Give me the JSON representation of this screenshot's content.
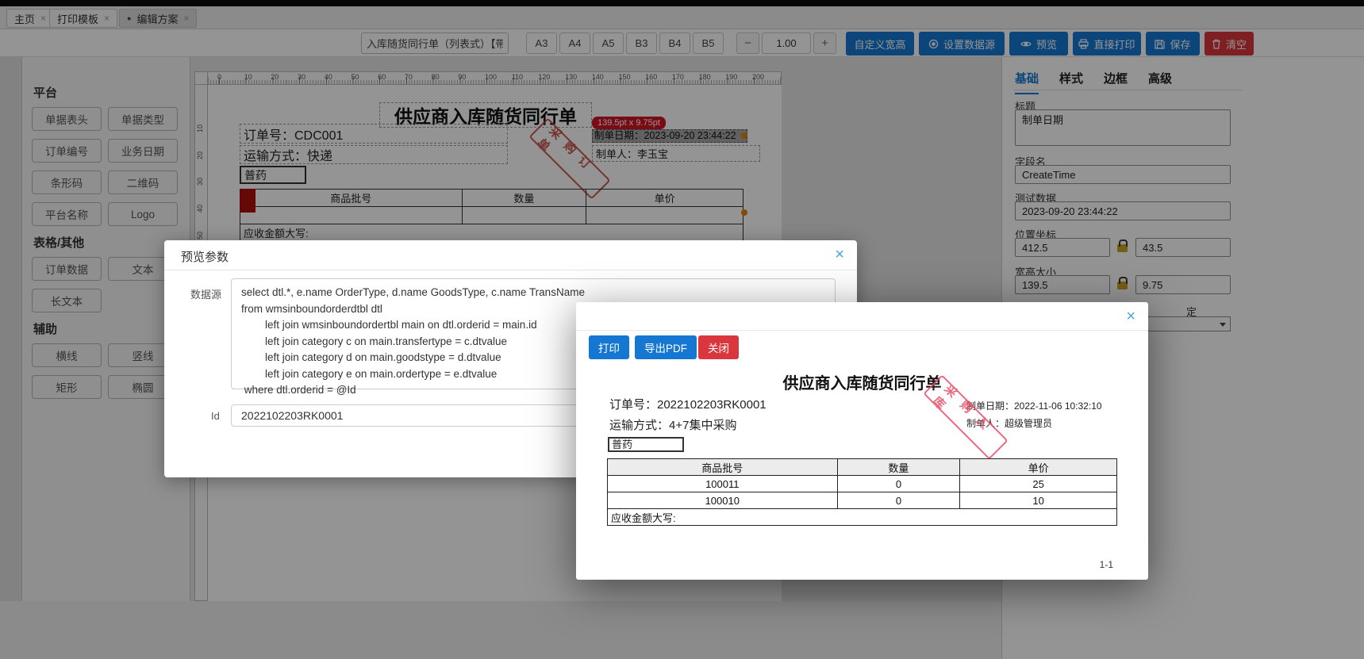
{
  "colors": {
    "primary": "#1677d2",
    "danger": "#d9363e",
    "tooltip-red": "#cf1322",
    "sel-gray": "#a8a8a8",
    "stamp1": "#bf3a35",
    "stamp2": "#e8506a",
    "lock-gold": "#c9a227",
    "tbl-red": "#b00f0f",
    "handle-orange": "#e08600"
  },
  "tabs": [
    {
      "label": "主页",
      "close": "×"
    },
    {
      "label": "打印模板",
      "close": "×"
    },
    {
      "label": "编辑方案",
      "dot": "●",
      "close": "×"
    }
  ],
  "toolbar": {
    "template_name": "入库随货同行单（列表式）【带",
    "paper_sizes": [
      "A3",
      "A4",
      "A5",
      "B3",
      "B4",
      "B5"
    ],
    "zoom_minus": "−",
    "zoom_value": "1.00",
    "zoom_plus": "+",
    "custom_size": "自定义宽高",
    "set_datasource": "设置数据源",
    "preview": "预览",
    "direct_print": "直接打印",
    "save": "保存",
    "clear": "清空"
  },
  "sidebar": {
    "sections": [
      {
        "title": "平台",
        "items": [
          "单据表头",
          "单据类型",
          "订单编号",
          "业务日期",
          "条形码",
          "二维码",
          "平台名称",
          "Logo"
        ]
      },
      {
        "title": "表格/其他",
        "items": [
          "订单数据",
          "文本",
          "长文本"
        ]
      },
      {
        "title": "辅助",
        "items": [
          "横线",
          "竖线",
          "矩形",
          "椭圆"
        ]
      }
    ]
  },
  "canvas": {
    "ruler_h": [
      "0",
      "10",
      "20",
      "30",
      "40",
      "50",
      "60",
      "70",
      "80",
      "90",
      "100",
      "110",
      "120",
      "130",
      "140",
      "150",
      "160",
      "170",
      "180",
      "190",
      "200"
    ],
    "ruler_v": [
      "10",
      "20",
      "30",
      "40",
      "50"
    ],
    "doc": {
      "title": "供应商入库随货同行单",
      "order_no": "订单号：CDC001",
      "transport": "运输方式：快递",
      "drug_type": "普药",
      "tooltip": "139.5pt x 9.75pt",
      "make_date": "制单日期：2023-09-20 23:44:22",
      "maker": "制单人：李玉宝",
      "stamp": "采购订单",
      "table_headers": [
        "商品批号",
        "数量",
        "单价"
      ],
      "amount_row": "应收金额大写:"
    }
  },
  "properties": {
    "tabs": [
      "基础",
      "样式",
      "边框",
      "高级"
    ],
    "title_label": "标题",
    "title_value": "制单日期",
    "field_label": "字段名",
    "field_value": "CreateTime",
    "test_label": "测试数据",
    "test_value": "2023-09-20 23:44:22",
    "pos_label": "位置坐标",
    "pos_x": "412.5",
    "pos_y": "43.5",
    "size_label": "宽高大小",
    "size_w": "139.5",
    "size_h": "9.75",
    "partial_label": "定"
  },
  "modal_params": {
    "title": "预览参数",
    "close": "×",
    "datasource_label": "数据源",
    "datasource_sql": "select dtl.*, e.name OrderType, d.name GoodsType, c.name TransName\nfrom wmsinboundorderdtbl dtl\n        left join wmsinboundordertbl main on dtl.orderid = main.id\n        left join category c on main.transfertype = c.dtvalue\n        left join category d on main.goodstype = d.dtvalue\n        left join category e on main.ordertype = e.dtvalue\n where dtl.orderid = @Id",
    "id_label": "Id",
    "id_value": "2022102203RK0001"
  },
  "modal_preview": {
    "close": "×",
    "print": "打印",
    "export_pdf": "导出PDF",
    "close_btn": "关闭",
    "doc_title": "供应商入库随货同行单",
    "order_no": "订单号：2022102203RK0001",
    "make_date": "制单日期：2022-11-06 10:32:10",
    "transport": "运输方式：4+7集中采购",
    "maker": "制单人：超级管理员",
    "drug_type": "普药",
    "stamp": "采购入库",
    "table": {
      "headers": [
        "商品批号",
        "数量",
        "单价"
      ],
      "rows": [
        [
          "100011",
          "0",
          "25"
        ],
        [
          "100010",
          "0",
          "10"
        ]
      ],
      "footer": "应收金额大写:"
    },
    "page_indicator": "1-1"
  }
}
